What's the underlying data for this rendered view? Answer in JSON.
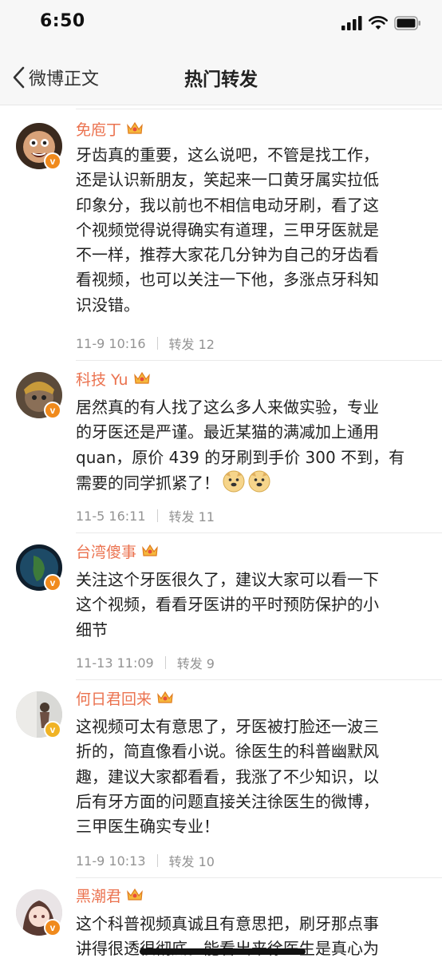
{
  "status": {
    "time": "6:50"
  },
  "nav": {
    "back_label": "微博正文",
    "title": "热门转发"
  },
  "comments": [
    {
      "name": "免庖丁",
      "text": [
        "牙齿真的重要，这么说吧，不管是找工作，",
        "还是认识新朋友，笑起来一口黄牙属实拉低",
        "印象分，我以前也不相信电动牙刷，看了这",
        "个视频觉得说得确实有道理，三甲牙医就是",
        "不一样，推荐大家花几分钟为自己的牙齿看",
        "看视频，也可以关注一下他，多涨点牙科知",
        "识没错。"
      ],
      "time": "11-9 10:16",
      "reposts": "转发 12"
    },
    {
      "name": "科技 Yu",
      "text": [
        "居然真的有人找了这么多人来做实验，专业",
        "的牙医还是严谨。最近某猫的满减加上通用",
        "quan，原价 439 的牙刷到手价 300 不到，有"
      ],
      "text_last": "需要的同学抓紧了！",
      "time": "11-5 16:11",
      "reposts": "转发 11"
    },
    {
      "name": "台湾傻事",
      "text": [
        "关注这个牙医很久了，建议大家可以看一下",
        "这个视频，看看牙医讲的平时预防保护的小",
        "细节"
      ],
      "time": "11-13 11:09",
      "reposts": "转发 9"
    },
    {
      "name": "何日君回来",
      "text": [
        "这视频可太有意思了，牙医被打脸还一波三",
        "折的，简直像看小说。徐医生的科普幽默风",
        "趣，建议大家都看看，我涨了不少知识，以",
        "后有牙方面的问题直接关注徐医生的微博，",
        "三甲医生确实专业！"
      ],
      "time": "11-9 10:13",
      "reposts": "转发 10"
    },
    {
      "name": "黑潮君",
      "text": [
        "这个科普视频真诚且有意思把，刷牙那点事",
        "讲得很透很彻底。能看出来徐医生是真心为"
      ]
    }
  ],
  "colors": {
    "username": "#eb7350",
    "verified_orange": "#f08a1c",
    "verified_yellow": "#f0b325",
    "meta": "#939393"
  }
}
